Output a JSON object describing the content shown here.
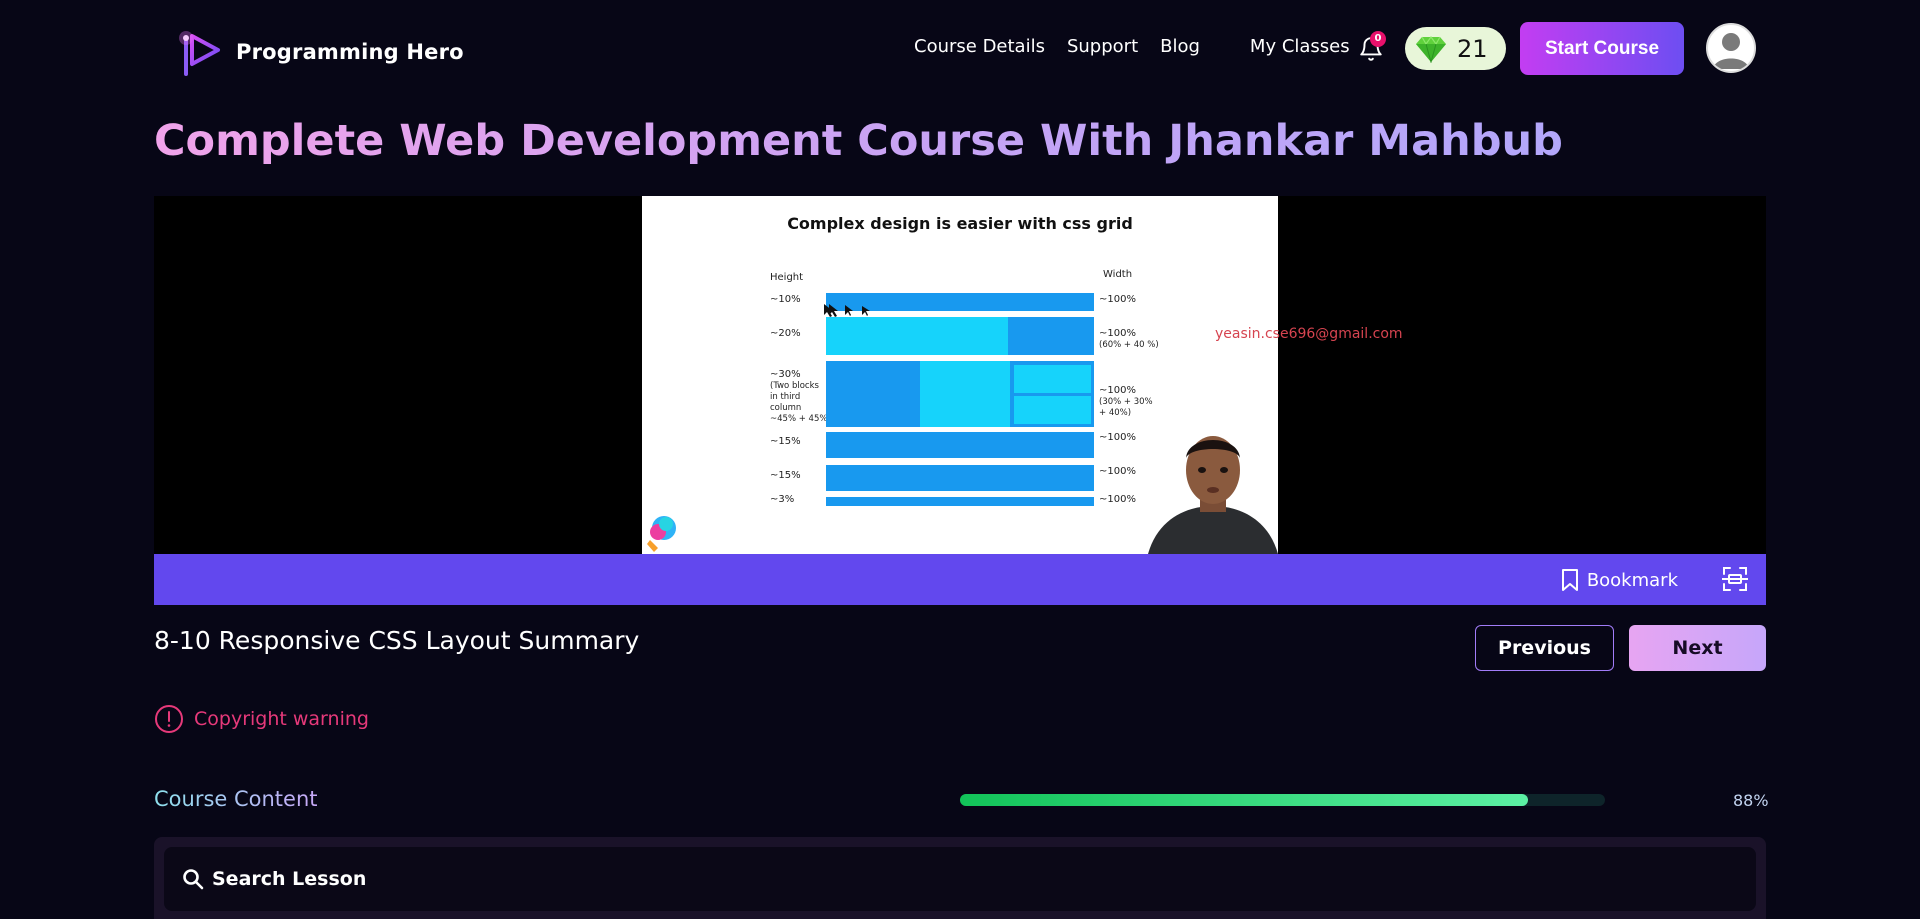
{
  "header": {
    "brand_name": "Programming Hero",
    "nav": {
      "course_details": "Course Details",
      "support": "Support",
      "blog": "Blog",
      "my_classes": "My Classes"
    },
    "notification_count": "0",
    "gem_count": "21",
    "start_course_label": "Start Course"
  },
  "course": {
    "title": "Complete Web Development Course With Jhankar Mahbub"
  },
  "video": {
    "slide_title": "Complex design is easier with css grid",
    "height_heading": "Height",
    "width_heading": "Width",
    "heights": [
      "~10%",
      "~20%",
      "~30%",
      "(Two blocks",
      "in third",
      "column",
      "~45% + 45%)",
      "~15%",
      "~15%",
      "~3%"
    ],
    "widths": [
      "~100%",
      "~100%",
      "(60% + 40 %)",
      "~100%",
      "(30% + 30%",
      "+ 40%)",
      "~100%",
      "~100%",
      "~100%"
    ],
    "watermark": "yeasin.cse696@gmail.com",
    "bookmark_label": "Bookmark"
  },
  "lesson": {
    "title": "8-10 Responsive CSS Layout Summary",
    "previous_label": "Previous",
    "next_label": "Next",
    "copyright_warning": "Copyright warning"
  },
  "course_content": {
    "label": "Course Content",
    "progress_percent": 88,
    "progress_label": "88%",
    "search_placeholder": "Search Lesson"
  },
  "colors": {
    "background": "#070616",
    "accent_purple": "#6248ee",
    "start_gradient_from": "#c33df2",
    "start_gradient_to": "#6d4ef2",
    "warning": "#e6397a",
    "progress_green": "#12c359"
  }
}
